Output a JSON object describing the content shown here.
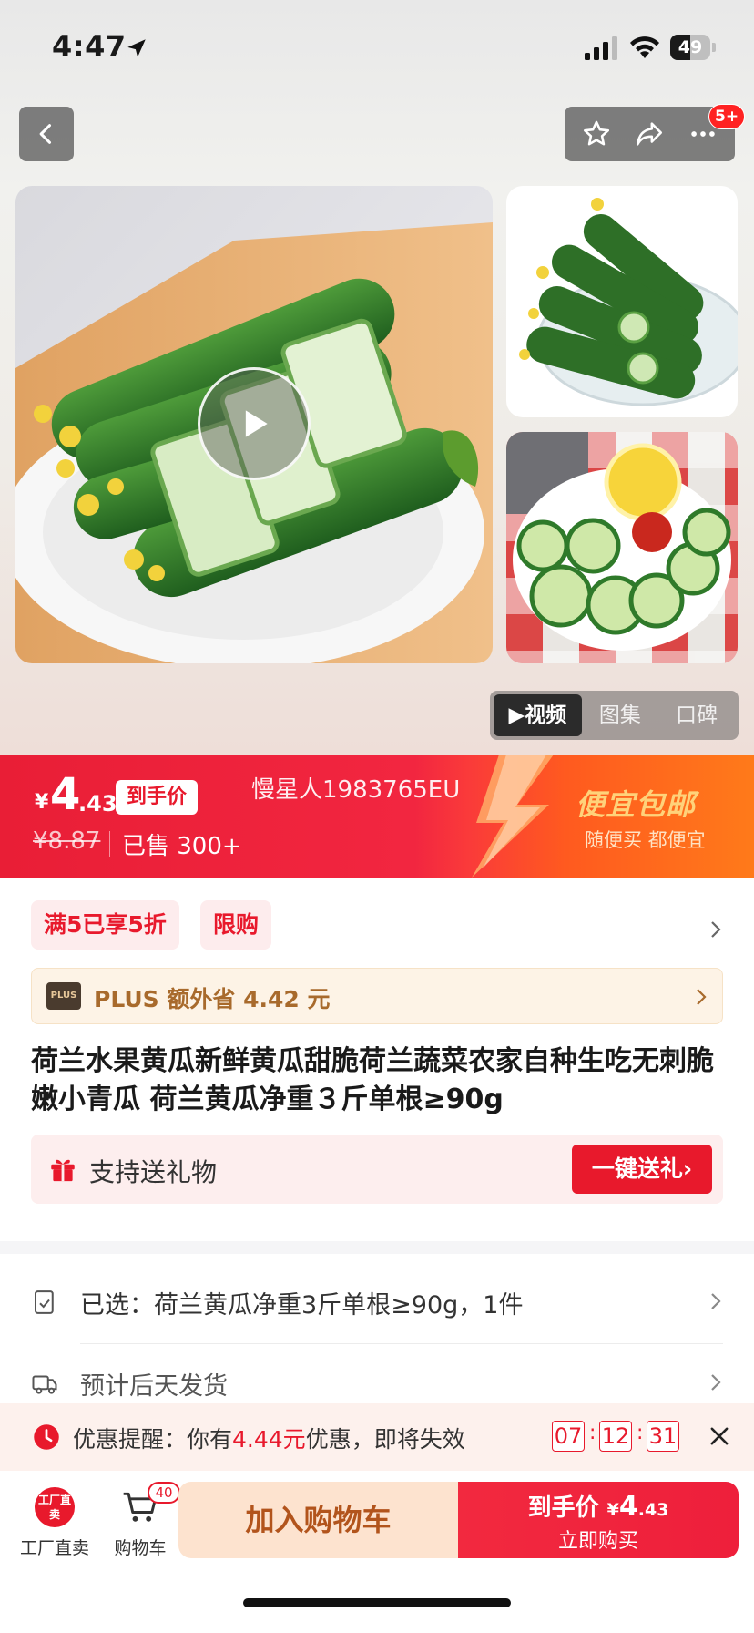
{
  "status_bar": {
    "time": "4:47",
    "battery": "49",
    "battery_percent": 0.49
  },
  "top_actions": {
    "notification_count": "5+"
  },
  "media_tabs": [
    {
      "label": "▶视频",
      "active": true
    },
    {
      "label": "图集",
      "active": false
    },
    {
      "label": "口碑",
      "active": false
    }
  ],
  "price_banner": {
    "currency": "¥",
    "price_int": "4",
    "price_dec": ".43",
    "price_tag": "到手价",
    "original_price": "¥8.87",
    "sold": "已售 300+",
    "watermark": "慢星人1983765EU",
    "promo_title": "便宜包邮",
    "promo_subtitle": "随便买 都便宜"
  },
  "tags": [
    "满5已享5折",
    "限购"
  ],
  "plus": {
    "logo": "PLUS",
    "text": "PLUS 额外省 4.42 元"
  },
  "product_title": "荷兰水果黄瓜新鲜黄瓜甜脆荷兰蔬菜农家自种生吃无刺脆嫩小青瓜 荷兰黄瓜净重３斤单根≥90g",
  "gift": {
    "text": "支持送礼物",
    "button": "一键送礼›"
  },
  "selected": "已选：荷兰黄瓜净重3斤单根≥90g，1件",
  "shipping": "预计后天发货",
  "reminder": {
    "prefix": "优惠提醒：你有",
    "amount": "4.44元",
    "suffix": "优惠，即将失效",
    "hours": "07",
    "minutes": "12",
    "seconds": "31"
  },
  "bottom_bar": {
    "factory_icon": "工厂直卖",
    "factory_label": "工厂直卖",
    "cart_label": "购物车",
    "cart_count": "40",
    "add_to_cart": "加入购物车",
    "buy_price_label": "到手价",
    "buy_currency": "¥",
    "buy_price": "4",
    "buy_price_dec": ".43",
    "buy_now": "立即购买"
  },
  "colors": {
    "accent": "#e8192c",
    "promo_gold": "#ffd27a",
    "plus_brown": "#a86a2c"
  },
  "icons": [
    "location-arrow-icon",
    "signal-icon",
    "wifi-icon",
    "back-icon",
    "star-icon",
    "share-icon",
    "more-icon",
    "play-icon",
    "chevron-right-icon",
    "gift-icon",
    "selection-icon",
    "truck-icon",
    "clock-icon",
    "close-icon",
    "cart-icon"
  ]
}
